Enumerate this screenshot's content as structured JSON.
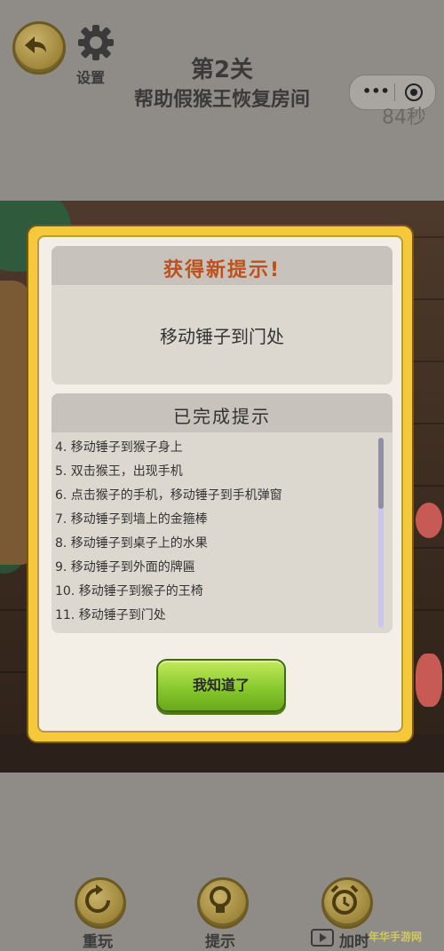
{
  "header": {
    "settings_label": "设置",
    "level": "第2关",
    "subtitle": "帮助假猴王恢复房间",
    "timer": "84秒",
    "capsule_more": "•••"
  },
  "dialog": {
    "new_hint_title": "获得新提示!",
    "new_hint_text": "移动锤子到门处",
    "done_title": "已完成提示",
    "done_items": [
      "4. 移动锤子到猴子身上",
      "5. 双击猴王，出现手机",
      "6. 点击猴子的手机，移动锤子到手机弹窗",
      "7. 移动锤子到墙上的金箍棒",
      "8. 移动锤子到桌子上的水果",
      "9. 移动锤子到外面的牌匾",
      "10. 移动锤子到猴子的王椅",
      "11. 移动锤子到门处"
    ],
    "ok_label": "我知道了"
  },
  "bottom": {
    "restart_label": "重玩",
    "hint_label": "提示",
    "time_label": "加时",
    "watermark": "年华手游网"
  },
  "colors": {
    "dialog_frame": "#f6c93a",
    "new_hint_title": "#c0501a",
    "ok_button": "#84c62a"
  }
}
